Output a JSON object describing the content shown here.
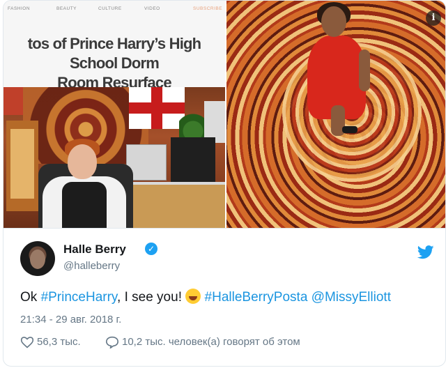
{
  "magazine_nav": [
    "FASHION",
    "BEAUTY",
    "CULTURE",
    "VIDEO",
    "SUBSCRIBE"
  ],
  "headline_line1": "tos of Prince Harry’s High School Dorm",
  "headline_line2": "Room Resurface",
  "info_glyph": "i",
  "tweet": {
    "author_name": "Halle Berry",
    "handle": "@halleberry",
    "text_prefix": "Ok ",
    "hashtag1": "#PrinceHarry",
    "text_middle": ", I see you! ",
    "hashtag2": "#HalleBerryPosta",
    "mention": "@MissyElliott",
    "timestamp": "21:34 - 29 авг. 2018 г.",
    "likes": "56,3 тыс.",
    "replies_text": "10,2 тыс. человек(а) говорят об этом"
  },
  "colors": {
    "link": "#1b95e0",
    "verified": "#1da1f2",
    "twitter_bird": "#1da1f2",
    "muted": "#657786"
  }
}
